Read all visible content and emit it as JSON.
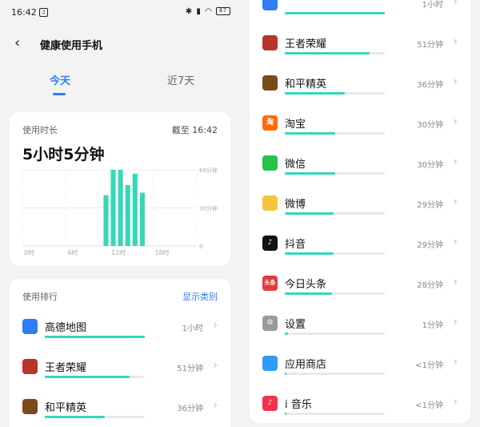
{
  "status": {
    "time": "16:42",
    "battery": "87"
  },
  "header": {
    "title": "健康使用手机"
  },
  "tabs": [
    {
      "label": "今天"
    },
    {
      "label": "近7天"
    }
  ],
  "usage": {
    "label": "使用时长",
    "as_of": "截至 16:42",
    "total": "5小时5分钟"
  },
  "chart_data": {
    "type": "bar",
    "x_ticks": [
      "0时",
      "6时",
      "12时",
      "18时"
    ],
    "y_ticks": [
      "60分钟",
      "30分钟",
      "0"
    ],
    "ylim": [
      0,
      60
    ],
    "hours": [
      11,
      12,
      13,
      14,
      15,
      16
    ],
    "values": [
      40,
      60,
      60,
      48,
      57,
      42
    ],
    "color": "#35d7b8"
  },
  "ranking": {
    "title": "使用排行",
    "action": "显示类别",
    "apps_left": [
      {
        "name": "高德地图",
        "duration": "1小时",
        "fill": 1.0,
        "icon": "amap-icon",
        "color": "#2f7cf6"
      },
      {
        "name": "王者荣耀",
        "duration": "51分钟",
        "fill": 0.85,
        "icon": "honor-of-kings-icon",
        "color": "#b8352b"
      },
      {
        "name": "和平精英",
        "duration": "36分钟",
        "fill": 0.6,
        "icon": "peace-elite-icon",
        "color": "#7a4a1a"
      }
    ],
    "apps_right": [
      {
        "name": "",
        "duration": "1小时",
        "fill": 1.0,
        "icon": "amap-icon",
        "color": "#2f7cf6"
      },
      {
        "name": "王者荣耀",
        "duration": "51分钟",
        "fill": 0.85,
        "icon": "honor-of-kings-icon",
        "color": "#b8352b"
      },
      {
        "name": "和平精英",
        "duration": "36分钟",
        "fill": 0.6,
        "icon": "peace-elite-icon",
        "color": "#7a4a1a"
      },
      {
        "name": "淘宝",
        "duration": "30分钟",
        "fill": 0.5,
        "icon": "taobao-icon",
        "color": "#ff6a00",
        "glyph": "淘"
      },
      {
        "name": "微信",
        "duration": "30分钟",
        "fill": 0.5,
        "icon": "wechat-icon",
        "color": "#27c34a"
      },
      {
        "name": "微博",
        "duration": "29分钟",
        "fill": 0.49,
        "icon": "weibo-icon",
        "color": "#f4c53b"
      },
      {
        "name": "抖音",
        "duration": "29分钟",
        "fill": 0.49,
        "icon": "douyin-icon",
        "color": "#111111",
        "glyph": "♪"
      },
      {
        "name": "今日头条",
        "duration": "28分钟",
        "fill": 0.47,
        "icon": "toutiao-icon",
        "color": "#e33b3b",
        "glyph": "头条"
      },
      {
        "name": "设置",
        "duration": "1分钟",
        "fill": 0.03,
        "icon": "settings-icon",
        "color": "#9a9a9a",
        "glyph": "⚙"
      },
      {
        "name": "应用商店",
        "duration": "<1分钟",
        "fill": 0.01,
        "icon": "app-store-icon",
        "color": "#2f9bf6"
      },
      {
        "name": "i 音乐",
        "duration": "<1分钟",
        "fill": 0.01,
        "icon": "i-music-icon",
        "color": "#f2334b",
        "glyph": "♪"
      }
    ]
  }
}
